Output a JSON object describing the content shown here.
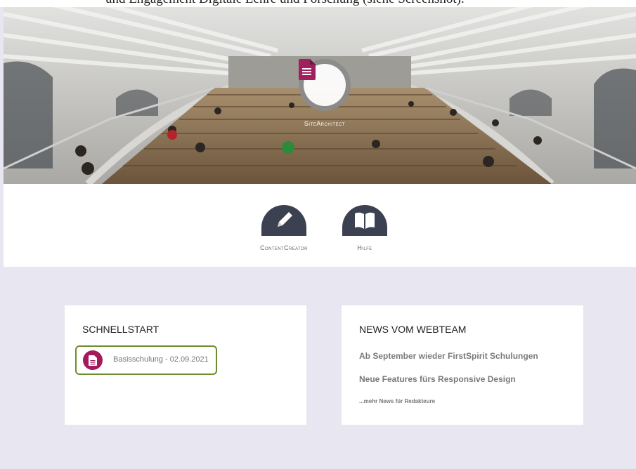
{
  "page_caption": "und Engagement Digitale Lehre und Forschung (siehe Screenshot).",
  "hero": {
    "app_name": "SiteArchitect",
    "badge_color": "#a3195b"
  },
  "apps": [
    {
      "label": "ContentCreator",
      "icon": "pencil-icon"
    },
    {
      "label": "Hilfe",
      "icon": "book-icon"
    }
  ],
  "quickstart": {
    "title": "SCHNELLSTART",
    "items": [
      {
        "label": "Basisschulung - 02.09.2021",
        "icon": "document-icon"
      }
    ],
    "highlight_color": "#6d8c2c"
  },
  "news": {
    "title": "NEWS VOM WEBTEAM",
    "items": [
      "Ab September wieder FirstSpirit Schulungen",
      "Neue Features fürs Responsive Design"
    ],
    "more_link": "...mehr News für Redakteure"
  }
}
